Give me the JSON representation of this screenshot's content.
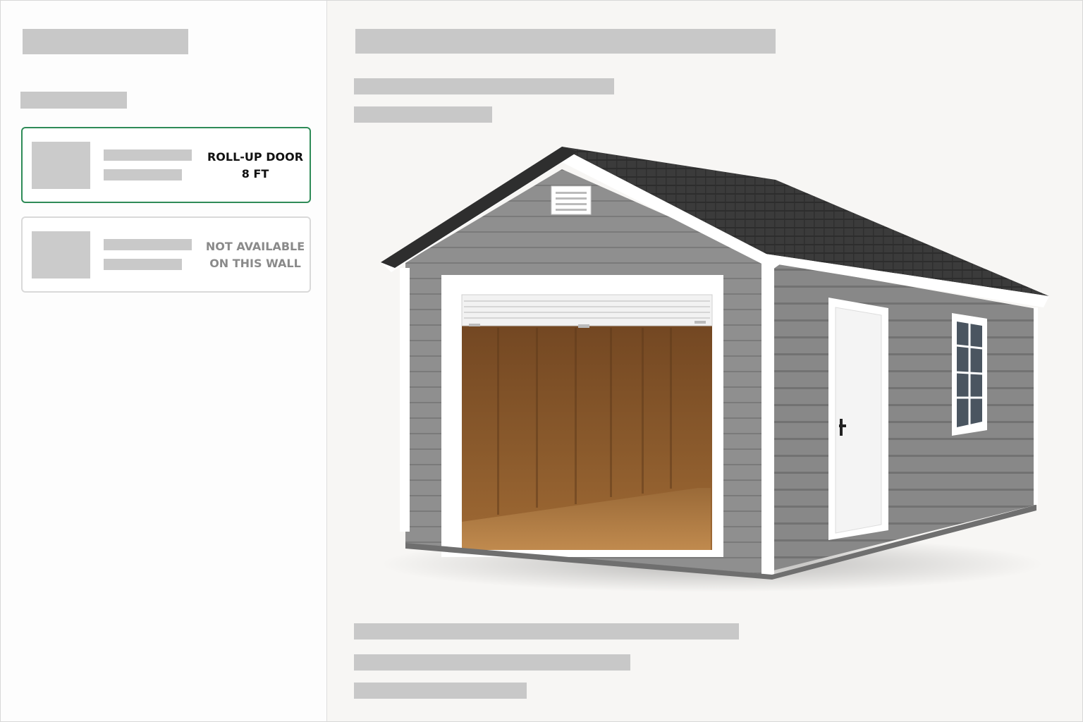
{
  "door_options": [
    {
      "status_line1": "ROLL-UP DOOR",
      "status_line2": "8 FT",
      "selected": true,
      "available": true
    },
    {
      "status_line1": "NOT AVAILABLE",
      "status_line2": "ON THIS WALL",
      "selected": false,
      "available": false
    }
  ],
  "colors": {
    "accent": "#2e8b57",
    "siding": "#8e8e8e",
    "trim": "#ffffff",
    "roof": "#3a3a3a",
    "interior_wood": "#8b5a2b",
    "placeholder": "#c8c8c8"
  },
  "preview": {
    "subject": "shed-with-roll-up-door"
  }
}
